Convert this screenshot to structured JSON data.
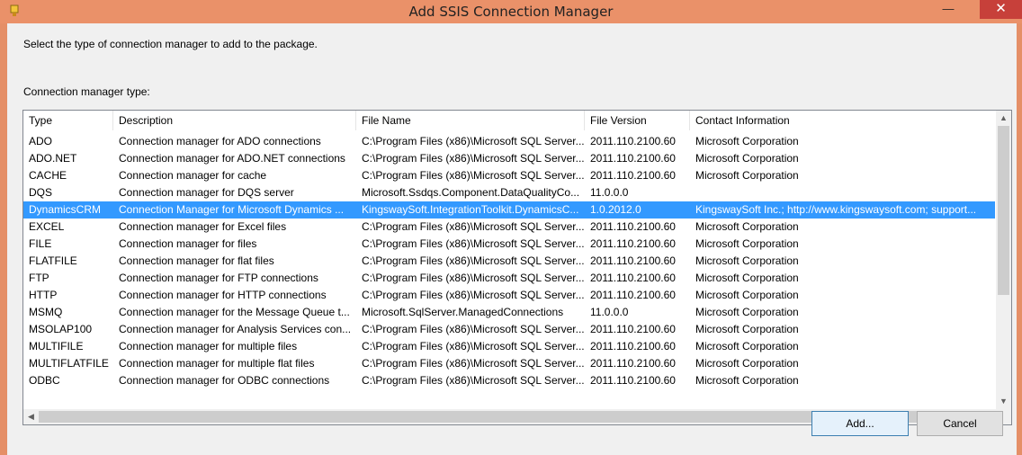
{
  "window": {
    "title": "Add SSIS Connection Manager"
  },
  "titlebar": {
    "minimize_glyph": "—",
    "close_glyph": "✕"
  },
  "instruction": "Select the type of connection manager to add to the package.",
  "type_label": "Connection manager type:",
  "columns": [
    "Type",
    "Description",
    "File Name",
    "File Version",
    "Contact Information"
  ],
  "rows": [
    {
      "type": "ADO",
      "description": "Connection manager for ADO connections",
      "file": "C:\\Program Files (x86)\\Microsoft SQL Server...",
      "version": "2011.110.2100.60",
      "contact": "Microsoft Corporation"
    },
    {
      "type": "ADO.NET",
      "description": "Connection manager for ADO.NET connections",
      "file": "C:\\Program Files (x86)\\Microsoft SQL Server...",
      "version": "2011.110.2100.60",
      "contact": "Microsoft Corporation"
    },
    {
      "type": "CACHE",
      "description": "Connection manager for cache",
      "file": "C:\\Program Files (x86)\\Microsoft SQL Server...",
      "version": "2011.110.2100.60",
      "contact": "Microsoft Corporation"
    },
    {
      "type": "DQS",
      "description": "Connection manager for DQS server",
      "file": "Microsoft.Ssdqs.Component.DataQualityCo...",
      "version": "11.0.0.0",
      "contact": ""
    },
    {
      "type": "DynamicsCRM",
      "description": "Connection Manager for Microsoft Dynamics ...",
      "file": "KingswaySoft.IntegrationToolkit.DynamicsC...",
      "version": "1.0.2012.0",
      "contact": "KingswaySoft Inc.; http://www.kingswaysoft.com; support...",
      "selected": true
    },
    {
      "type": "EXCEL",
      "description": "Connection manager for Excel files",
      "file": "C:\\Program Files (x86)\\Microsoft SQL Server...",
      "version": "2011.110.2100.60",
      "contact": "Microsoft Corporation"
    },
    {
      "type": "FILE",
      "description": "Connection manager for files",
      "file": "C:\\Program Files (x86)\\Microsoft SQL Server...",
      "version": "2011.110.2100.60",
      "contact": "Microsoft Corporation"
    },
    {
      "type": "FLATFILE",
      "description": "Connection manager for flat files",
      "file": "C:\\Program Files (x86)\\Microsoft SQL Server...",
      "version": "2011.110.2100.60",
      "contact": "Microsoft Corporation"
    },
    {
      "type": "FTP",
      "description": "Connection manager for FTP connections",
      "file": "C:\\Program Files (x86)\\Microsoft SQL Server...",
      "version": "2011.110.2100.60",
      "contact": "Microsoft Corporation"
    },
    {
      "type": "HTTP",
      "description": "Connection manager for HTTP connections",
      "file": "C:\\Program Files (x86)\\Microsoft SQL Server...",
      "version": "2011.110.2100.60",
      "contact": "Microsoft Corporation"
    },
    {
      "type": "MSMQ",
      "description": "Connection manager for the Message Queue t...",
      "file": "Microsoft.SqlServer.ManagedConnections",
      "version": "11.0.0.0",
      "contact": "Microsoft Corporation"
    },
    {
      "type": "MSOLAP100",
      "description": "Connection manager for Analysis Services con...",
      "file": "C:\\Program Files (x86)\\Microsoft SQL Server...",
      "version": "2011.110.2100.60",
      "contact": "Microsoft Corporation"
    },
    {
      "type": "MULTIFILE",
      "description": "Connection manager for multiple files",
      "file": "C:\\Program Files (x86)\\Microsoft SQL Server...",
      "version": "2011.110.2100.60",
      "contact": "Microsoft Corporation"
    },
    {
      "type": "MULTIFLATFILE",
      "description": "Connection manager for multiple flat files",
      "file": "C:\\Program Files (x86)\\Microsoft SQL Server...",
      "version": "2011.110.2100.60",
      "contact": "Microsoft Corporation"
    },
    {
      "type": "ODBC",
      "description": "Connection manager for ODBC connections",
      "file": "C:\\Program Files (x86)\\Microsoft SQL Server...",
      "version": "2011.110.2100.60",
      "contact": "Microsoft Corporation"
    }
  ],
  "buttons": {
    "add": "Add...",
    "cancel": "Cancel"
  },
  "colors": {
    "titlebar": "#ea9169",
    "selection": "#3399ff",
    "close": "#c7403a"
  },
  "icons": {
    "app": "ssis-package-icon",
    "up": "chevron-up-icon",
    "down": "chevron-down-icon",
    "left": "chevron-left-icon",
    "right": "chevron-right-icon"
  }
}
